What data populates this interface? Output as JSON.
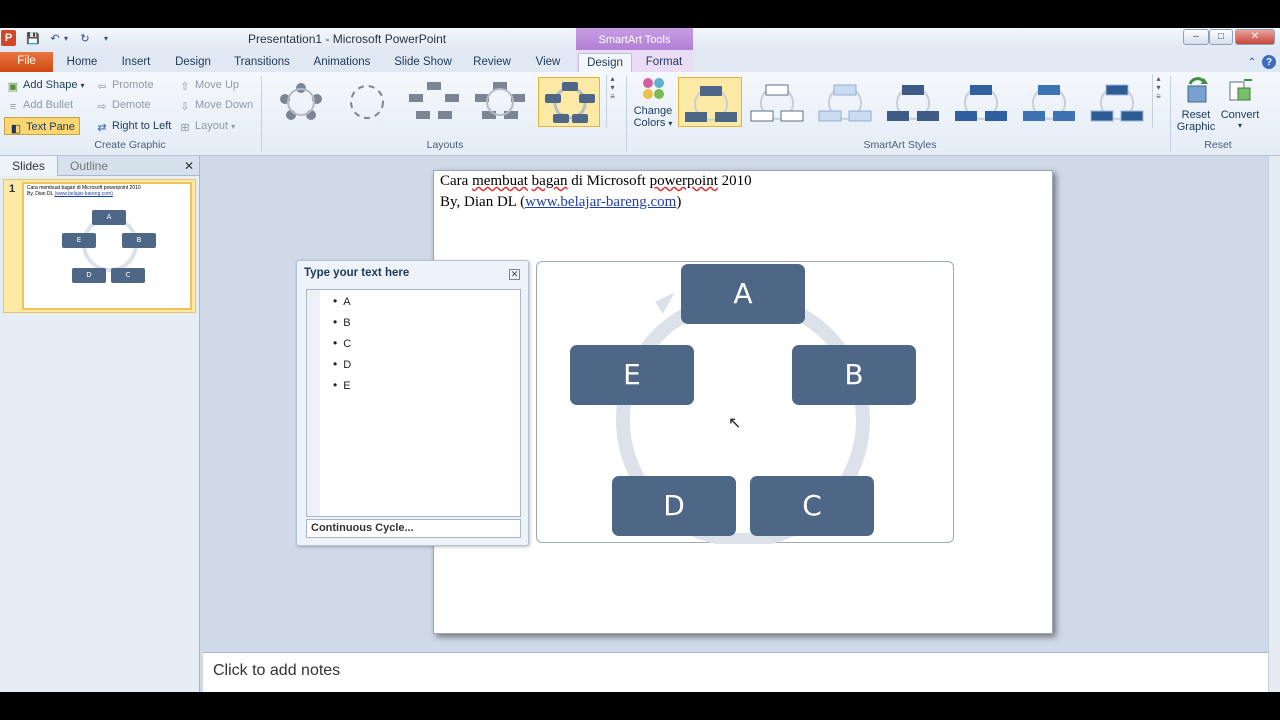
{
  "window": {
    "title": "Presentation1  -  Microsoft PowerPoint",
    "context_tool_group": "SmartArt Tools",
    "app_icon": "P"
  },
  "tabs": [
    {
      "label": "File"
    },
    {
      "label": "Home"
    },
    {
      "label": "Insert"
    },
    {
      "label": "Design"
    },
    {
      "label": "Transitions"
    },
    {
      "label": "Animations"
    },
    {
      "label": "Slide Show"
    },
    {
      "label": "Review"
    },
    {
      "label": "View"
    },
    {
      "label": "Design"
    },
    {
      "label": "Format"
    }
  ],
  "ribbon": {
    "create_graphic": {
      "label": "Create Graphic",
      "add_shape": "Add Shape",
      "add_bullet": "Add Bullet",
      "text_pane": "Text Pane",
      "promote": "Promote",
      "demote": "Demote",
      "right_to_left": "Right to Left",
      "move_up": "Move Up",
      "move_down": "Move Down",
      "layout": "Layout"
    },
    "layouts": {
      "label": "Layouts"
    },
    "smartart_styles": {
      "label": "SmartArt Styles",
      "change_colors_line1": "Change",
      "change_colors_line2": "Colors"
    },
    "reset": {
      "label": "Reset",
      "reset_graphic_line1": "Reset",
      "reset_graphic_line2": "Graphic",
      "convert": "Convert"
    }
  },
  "left_pane": {
    "tab_slides": "Slides",
    "tab_outline": "Outline",
    "slide_number": "1",
    "thumb_title": "Cara membuat bagan di Microsoft powerpoint 2010",
    "thumb_byline": "By, Dian DL",
    "thumb_link": "(www.belajar-bareng.com)",
    "thumb_nodes": [
      "A",
      "B",
      "C",
      "D",
      "E"
    ]
  },
  "slide": {
    "title_line1_a": "Cara",
    "title_line1_b": "membuat",
    "title_line1_c": "bagan",
    "title_line1_d": "di Microsoft",
    "title_line1_e": "powerpoint",
    "title_line1_f": "2010",
    "byline": "By, Dian DL",
    "link_open": "(",
    "link": "www.belajar-bareng.com",
    "link_close": ")",
    "nodes": {
      "a": "A",
      "b": "B",
      "c": "C",
      "d": "D",
      "e": "E"
    },
    "node_color": "#4f6786",
    "cycle_color": "#dde2ea"
  },
  "text_pane": {
    "title": "Type your text here",
    "items": [
      "A",
      "B",
      "C",
      "D",
      "E"
    ],
    "layout_name": "Continuous Cycle..."
  },
  "notes": {
    "placeholder": "Click to add notes"
  }
}
